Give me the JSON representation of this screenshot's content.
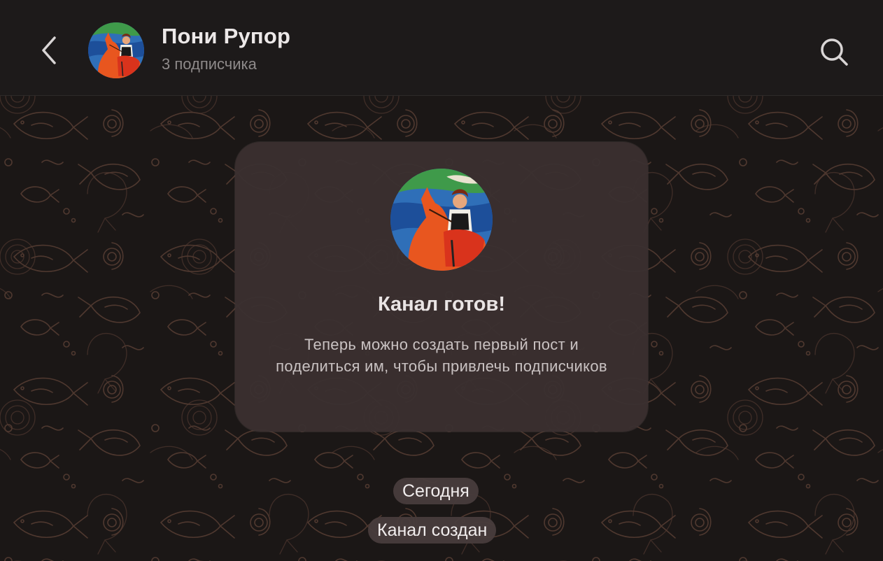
{
  "header": {
    "back_icon": "chevron-left-icon",
    "title": "Пони Рупор",
    "subtitle": "3 подписчика",
    "search_icon": "search-icon"
  },
  "card": {
    "title": "Канал готов!",
    "text": "Теперь можно создать первый пост и поделиться им, чтобы привлечь подписчиков"
  },
  "service": {
    "date_label": "Сегодня",
    "created_label": "Канал создан"
  },
  "colors": {
    "background": "#181414",
    "header": "#1d1a1a",
    "card": "#3a3030",
    "pattern": "#5a3f35"
  }
}
